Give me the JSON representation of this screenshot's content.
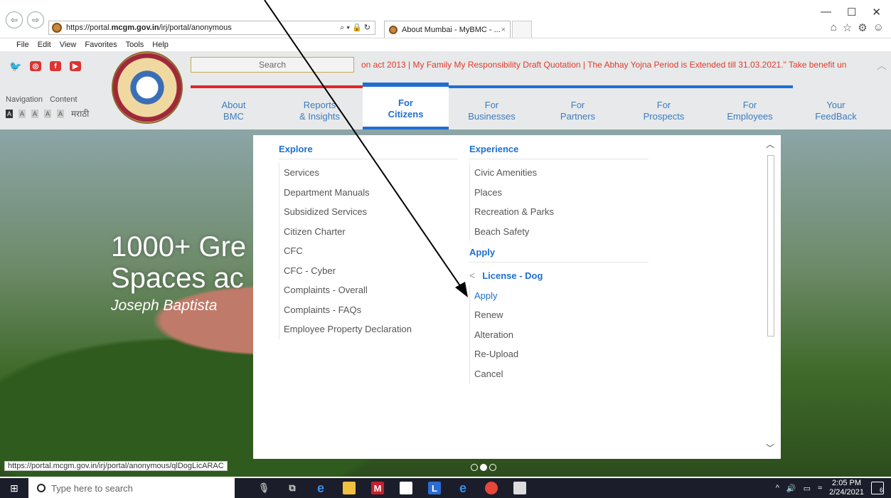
{
  "browser": {
    "address_prefix": "https://portal.",
    "address_domain": "mcgm.gov.in",
    "address_suffix": "/irj/portal/anonymous",
    "address_tools": "⌕ ▾ 🔒 ↻",
    "tab_title": "About Mumbai - MyBMC - ...",
    "tab_close": "×",
    "window_controls": [
      "—",
      "☐",
      "✕"
    ],
    "right_icons": [
      "⌂",
      "☆",
      "⚙",
      "☺"
    ],
    "menu": [
      "File",
      "Edit",
      "View",
      "Favorites",
      "Tools",
      "Help"
    ],
    "status_url": "https://portal.mcgm.gov.in/irj/portal/anonymous/qlDogLicARAC"
  },
  "site": {
    "social_icons": [
      "twitter-icon",
      "instagram-icon",
      "facebook-icon",
      "youtube-icon"
    ],
    "nav_links": [
      "Navigation",
      "Content"
    ],
    "a11y_sizes": [
      "A",
      "A",
      "A",
      "A",
      "A"
    ],
    "language_label": "मराठी",
    "search_placeholder": "Search",
    "ticker_text": "on act 2013 | My Family My Responsibility Draft Quotation | The Abhay Yojna Period is Extended till 31.03.2021.\" Take benefit un",
    "main_nav": [
      {
        "line1": "About",
        "line2": "BMC"
      },
      {
        "line1": "Reports",
        "line2": "& Insights"
      },
      {
        "line1": "For",
        "line2": "Citizens"
      },
      {
        "line1": "For",
        "line2": "Businesses"
      },
      {
        "line1": "For",
        "line2": "Partners"
      },
      {
        "line1": "For",
        "line2": "Prospects"
      },
      {
        "line1": "For",
        "line2": "Employees"
      },
      {
        "line1": "Your",
        "line2": "FeedBack"
      }
    ]
  },
  "hero": {
    "title_line1": "1000+ Gre",
    "title_line2": "Spaces ac",
    "subtitle": "Joseph Baptista"
  },
  "mega_menu": {
    "explore": {
      "heading": "Explore",
      "items": [
        "Services",
        "Department Manuals",
        "Subsidized Services",
        "Citizen Charter",
        "CFC",
        "CFC - Cyber",
        "Complaints - Overall",
        "Complaints - FAQs",
        "Employee Property Declaration"
      ]
    },
    "experience": {
      "heading": "Experience",
      "items": [
        "Civic Amenities",
        "Places",
        "Recreation & Parks",
        "Beach Safety"
      ]
    },
    "apply": {
      "heading": "Apply",
      "submenu_title": "License - Dog",
      "items": [
        "Apply",
        "Renew",
        "Alteration",
        "Re-Upload",
        "Cancel"
      ]
    }
  },
  "taskbar": {
    "search_placeholder": "Type here to search",
    "time": "2:05 PM",
    "date": "2/24/2021",
    "notification_count": "6"
  }
}
